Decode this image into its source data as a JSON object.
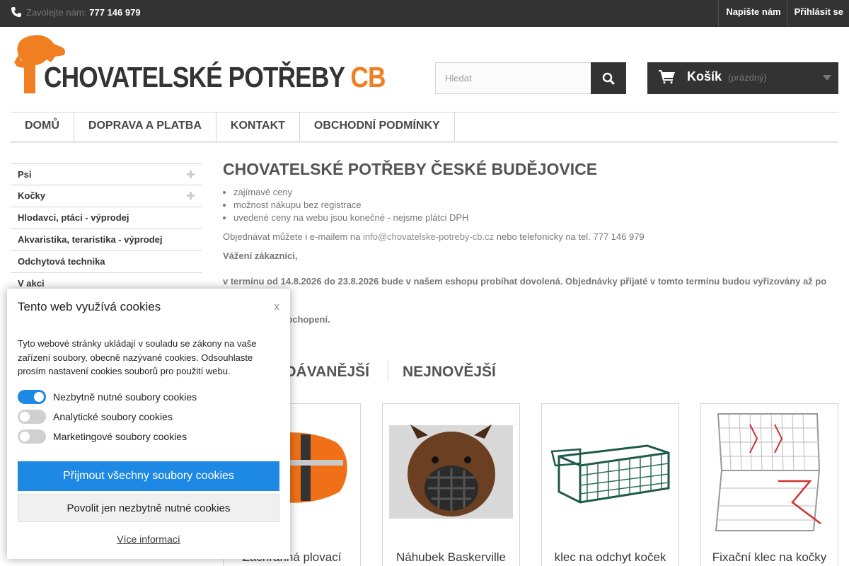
{
  "topbar": {
    "call_label": "Zavolejte nám:",
    "phone": "777 146 979",
    "links": [
      "Napište nám",
      "Přihlásit se"
    ]
  },
  "header": {
    "logo_text": "CHOVATELSKÉ POTŘEBY",
    "logo_cb": "CB",
    "search_placeholder": "Hledat",
    "cart_label": "Košík",
    "cart_status": "(prázdný)"
  },
  "menu": [
    "Domů",
    "Doprava a platba",
    "Kontakt",
    "Obchodní podmínky"
  ],
  "sidebar": {
    "items": [
      {
        "label": "Psi"
      },
      {
        "label": "Kočky"
      },
      {
        "label": "Hlodavci, ptáci - výprodej"
      },
      {
        "label": "Akvaristika, teraristika - výprodej"
      },
      {
        "label": "Odchytová technika"
      },
      {
        "label": "V akci"
      }
    ]
  },
  "main": {
    "title": "CHOVATELSKÉ POTŘEBY ČESKÉ BUDĚJOVICE",
    "bullets": [
      "zajímavé ceny",
      "možnost nákupu bez registrace",
      "uvedené ceny na webu jsou konečné - nejsme plátci DPH"
    ],
    "order_prefix": "Objednávat můžete i e-mailem na ",
    "email": "info@chovatelske-potreby-cb.cz",
    "order_suffix": " nebo telefonicky na tel. 777 146 979",
    "greeting": "Vážení zákazníci,",
    "notice": "v termínu od 14.8.2026 do 23.8.2026 bude v našem eshopu probíhat dovolená.  Objednávky přijaté v tomto termínu budou vyřizovány až po dovolené.",
    "thanks": "Děkujeme za pochopení."
  },
  "tabs": [
    "Nejprodávanější",
    "Nejnovější"
  ],
  "products": [
    {
      "name": "Záchranná plovací"
    },
    {
      "name": "Náhubek Baskerville"
    },
    {
      "name": "klec na odchyt koček"
    },
    {
      "name": "Fixační klec na kočky"
    }
  ],
  "cookie": {
    "title": "Tento web využívá cookies",
    "close": "x",
    "text": "Tyto webové stránky ukládají v souladu se zákony na vaše zařízení soubory, obecně nazývané cookies. Odsouhlaste prosím nastavení cookies souborů pro použití webu.",
    "toggles": [
      {
        "label": "Nezbytně nutné soubory cookies",
        "on": true
      },
      {
        "label": "Analytické soubory cookies",
        "on": false
      },
      {
        "label": "Marketingové soubory cookies",
        "on": false
      }
    ],
    "accept_all": "Přijmout všechny soubory cookies",
    "necessary_only": "Povolit jen nezbytně nutné cookies",
    "more": "Více informací"
  },
  "colors": {
    "accent": "#f07f21",
    "dark": "#333333",
    "cookie_button": "#1e88e5"
  }
}
